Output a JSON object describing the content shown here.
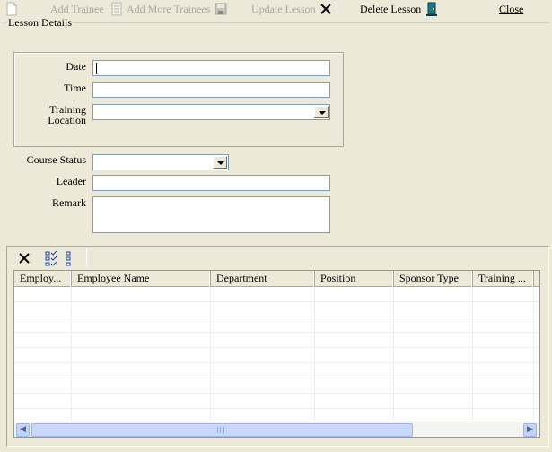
{
  "toolbar": {
    "add_trainee": "Add Trainee",
    "add_more_trainees": "Add More Trainees",
    "update_lesson": "Update Lesson",
    "delete_lesson": "Delete Lesson",
    "close": "Close"
  },
  "lesson_details": {
    "title": "Lesson Details",
    "date_label": "Date",
    "date_value": "",
    "time_label": "Time",
    "time_value": "",
    "training_location_label_1": "Training",
    "training_location_label_2": "Location",
    "training_location_value": "",
    "course_status_label": "Course Status",
    "course_status_value": "",
    "leader_label": "Leader",
    "leader_value": "",
    "remark_label": "Remark",
    "remark_value": ""
  },
  "grid": {
    "columns": [
      "Employ...",
      "Employee Name",
      "Department",
      "Position",
      "Sponsor Type",
      "Training ..."
    ],
    "rows": []
  },
  "icons": {
    "new": "new-document-icon",
    "add_more": "list-add-icon",
    "save": "floppy-disk-icon",
    "delete": "delete-x-icon",
    "exit": "exit-door-icon",
    "grid_delete": "delete-x-icon",
    "grid_check": "check-list-icon",
    "grid_uncheck": "uncheck-list-icon"
  },
  "colors": {
    "background": "#ece9d8",
    "disabled_text": "#a8a79a",
    "field_border": "#7f9db9",
    "scroll_thumb": "#c8d7fa"
  }
}
